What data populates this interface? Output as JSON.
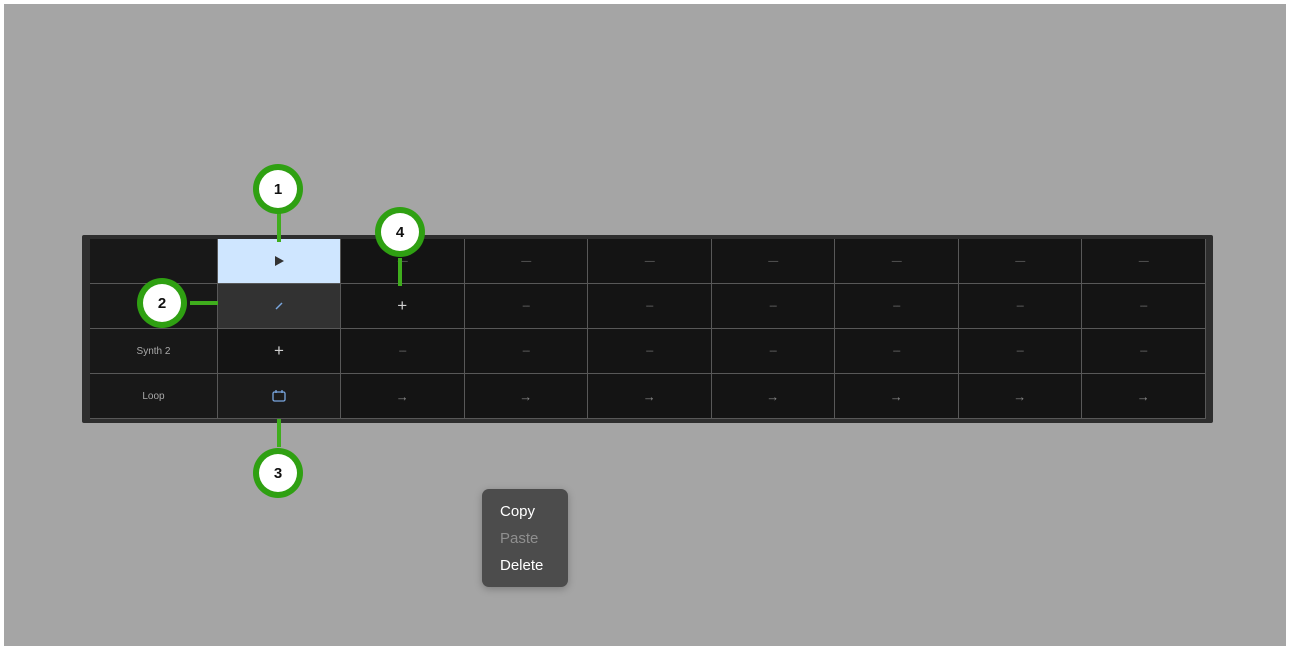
{
  "colors": {
    "background": "#a5a5a5",
    "grid_bg": "#141414",
    "selected_play_cell": "#cfe6ff",
    "callout_green": "#2fa012",
    "menu_bg": "#4c4c4c"
  },
  "rows": {
    "r1": {
      "name": "",
      "first_icon": "play-icon",
      "slots": [
        "—",
        "—",
        "—",
        "—",
        "—",
        "—",
        "—"
      ]
    },
    "r2": {
      "name": "",
      "first_icon": "pencil-icon",
      "second": "+",
      "slots": [
        "---",
        "---",
        "---",
        "---",
        "---",
        "---"
      ]
    },
    "r3": {
      "name": "Synth 2",
      "first": "+",
      "slots": [
        "---",
        "---",
        "---",
        "---",
        "---",
        "---",
        "---"
      ]
    },
    "r4": {
      "name": "Loop",
      "first_icon": "loop-icon",
      "slots": [
        "→",
        "→",
        "→",
        "→",
        "→",
        "→",
        "→"
      ]
    }
  },
  "callouts": {
    "c1": "1",
    "c2": "2",
    "c3": "3",
    "c4": "4"
  },
  "context_menu": {
    "copy": "Copy",
    "paste": "Paste",
    "delete": "Delete"
  }
}
